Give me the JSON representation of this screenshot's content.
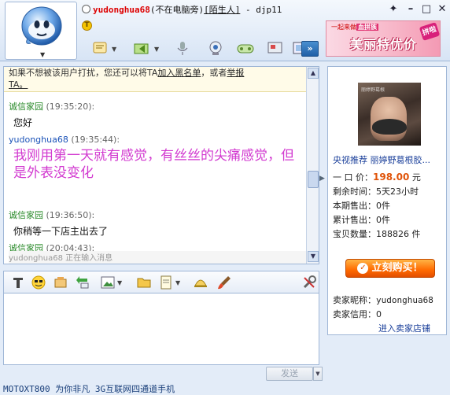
{
  "header": {
    "contact_name": "yudonghua68",
    "contact_status": "(不在电脑旁)",
    "relation": "[陌生人]",
    "separator": "-",
    "self_name": "djp11"
  },
  "banner": {
    "line1_prefix": "一起来做",
    "line1_highlight": "血拼族",
    "headline": "美丽特优价",
    "tag": "拼啦"
  },
  "notice": {
    "text_before": "如果不想被该用户打扰，您还可以将TA",
    "link1": "加入黑名单",
    "text_middle": "，或者",
    "link2": "举报",
    "text_end": "TA。"
  },
  "messages": [
    {
      "name": "诚信家园",
      "time": "(19:35:20):",
      "body": "您好"
    },
    {
      "name": "yudonghua68",
      "time": "(19:35:44):",
      "body": "我刚用第一天就有感觉，有丝丝的尖痛感觉，但是外表没变化"
    },
    {
      "name": "诚信家园",
      "time": "(19:36:50):",
      "body": "你稍等一下店主出去了"
    },
    {
      "name": "诚信家园",
      "time": "(20:04:43):",
      "body": ""
    }
  ],
  "typing_indicator": "yudonghua68 正在输入消息",
  "send_button": "发送",
  "status_bar": "MOTOXT800 为你非凡 3G互联网四通道手机",
  "product": {
    "title_prefix": "央视推荐",
    "title": "丽婷野葛根胶...",
    "image_watermark": "丽婷野葛根",
    "price_label": "一 口 价：",
    "price": "198.00",
    "price_unit": "元",
    "remaining_label": "剩余时间：",
    "remaining": "5天23小时",
    "period_sold_label": "本期售出：",
    "period_sold": "0件",
    "total_sold_label": "累计售出：",
    "total_sold": "0件",
    "stock_label": "宝贝数量：",
    "stock": "188826 件",
    "buy_button": "立刻购买！",
    "seller_nick_label": "卖家昵称：",
    "seller_nick": "yudonghua68",
    "seller_credit_label": "卖家信用：",
    "seller_credit": "0",
    "shop_link": "进入卖家店铺"
  },
  "colors": {
    "accent_blue": "#1a52b8",
    "seller_green": "#2a8a2a",
    "highlight_text": "#d23ad0",
    "price": "#e0540a",
    "buy_button": "#ff6a00"
  }
}
